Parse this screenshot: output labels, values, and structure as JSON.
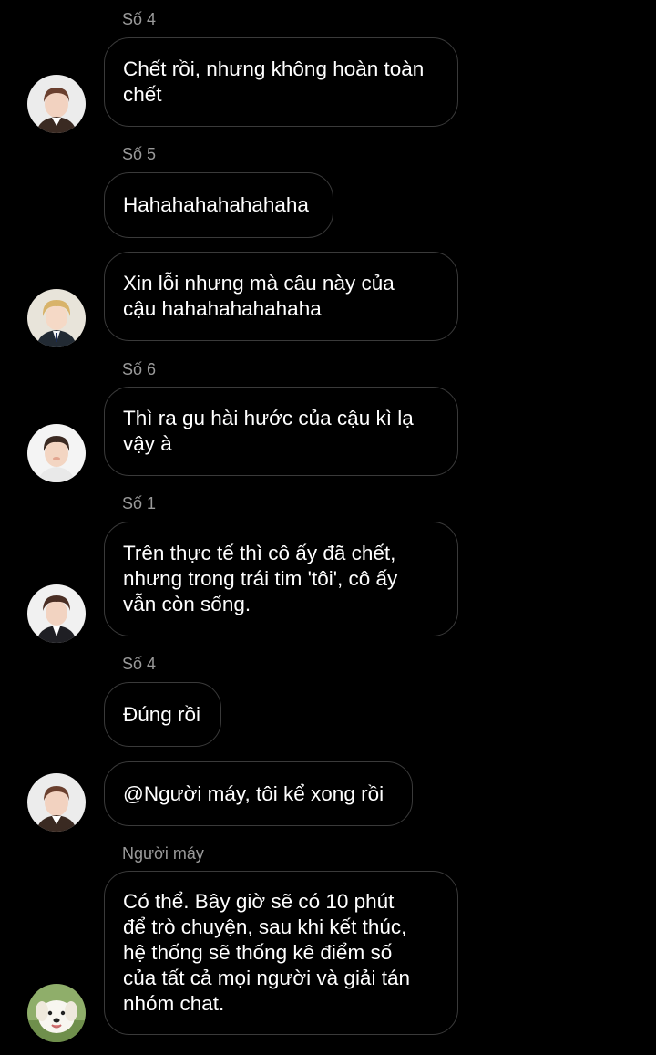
{
  "messages": [
    {
      "sender": "Số 4",
      "text": "Chết rồi, nhưng không hoàn toàn\nchết",
      "avatar": "boy-avatar-icon"
    },
    {
      "sender": "Số 5",
      "text": "Hahahahahahahaha",
      "avatar": ""
    },
    {
      "sender": "",
      "text": "Xin lỗi nhưng mà câu này của\ncậu hahahahahahaha",
      "avatar": "blond-boy-avatar-icon"
    },
    {
      "sender": "Số 6",
      "text": "Thì ra gu hài hước của cậu kì lạ\nvậy à",
      "avatar": "boy-avatar-icon"
    },
    {
      "sender": "Số 1",
      "text": "Trên thực tế thì cô ấy đã chết,\nnhưng trong trái tim 'tôi', cô ấy\nvẫn còn sống.",
      "avatar": "boy-avatar-icon"
    },
    {
      "sender": "Số 4",
      "text": "Đúng rồi",
      "avatar": ""
    },
    {
      "sender": "",
      "text": "@Người máy, tôi kể xong rồi",
      "avatar": "boy-avatar-icon"
    },
    {
      "sender": "Người máy",
      "text": "Có thể. Bây giờ sẽ có 10 phút\nđể trò chuyện, sau khi kết thúc,\nhệ thống sẽ thống kê điểm số\ncủa tất cả mọi người và giải tán\nnhóm chat.",
      "avatar": "dog-avatar-icon"
    }
  ],
  "colors": {
    "background": "#000000",
    "bubble_border": "#3a3a3a",
    "sender_text": "#9a9a9a",
    "message_text": "#ffffff"
  }
}
